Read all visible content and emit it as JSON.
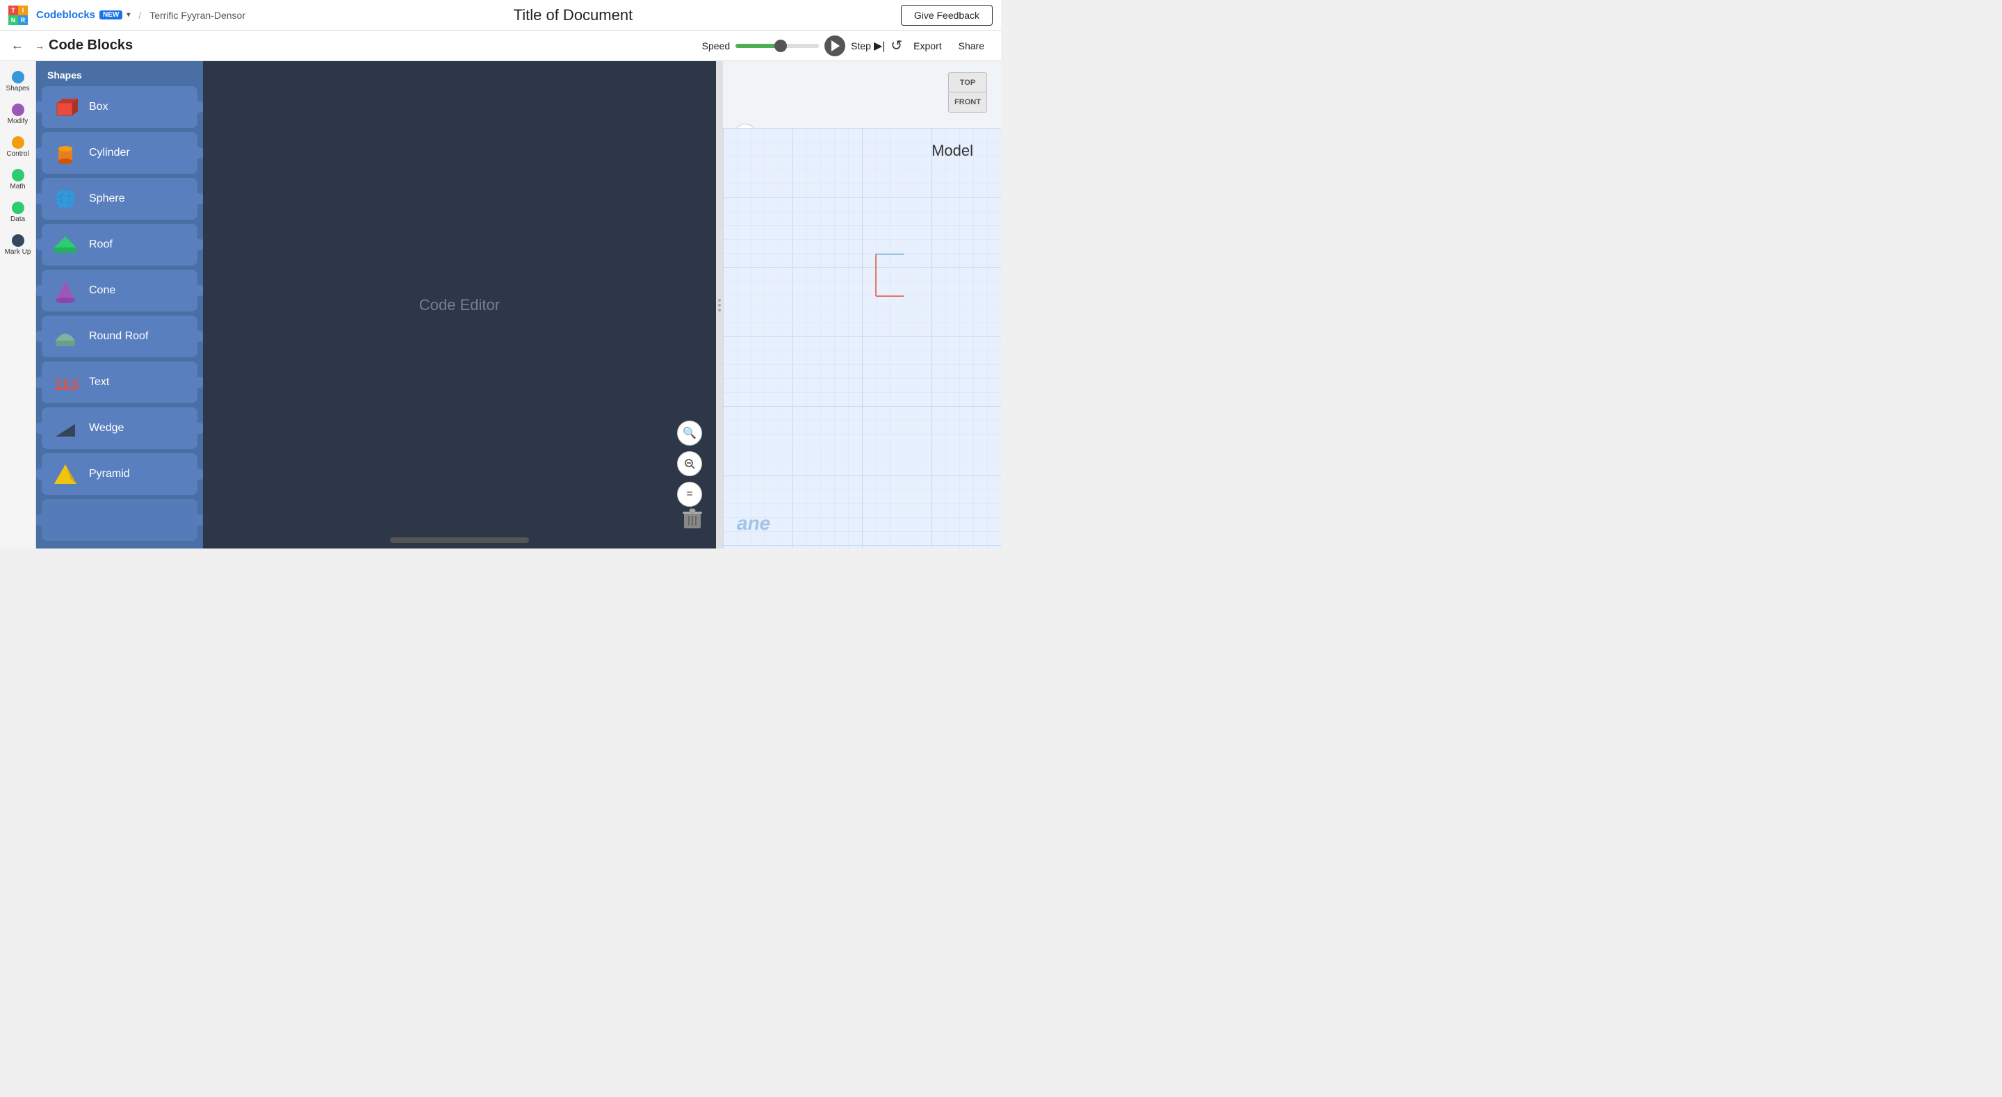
{
  "topbar": {
    "logo": {
      "letters": [
        "T",
        "I",
        "N",
        "R"
      ]
    },
    "codeblocks_label": "Codeblocks",
    "new_badge": "NEW",
    "project_name": "Terrific Fyyran-Densor",
    "doc_title": "Title of Document",
    "give_feedback_label": "Give Feedback"
  },
  "toolbar": {
    "back_icon": "←",
    "arrow_icon": "→",
    "title": "Code Blocks",
    "speed_label": "Speed",
    "step_label": "Step",
    "export_label": "Export",
    "share_label": "Share"
  },
  "categories": [
    {
      "id": "shapes",
      "label": "Shapes",
      "dot_class": "dot-blue"
    },
    {
      "id": "modify",
      "label": "Modify",
      "dot_class": "dot-purple"
    },
    {
      "id": "control",
      "label": "Control",
      "dot_class": "dot-orange"
    },
    {
      "id": "math",
      "label": "Math",
      "dot_class": "dot-green"
    },
    {
      "id": "data",
      "label": "Data",
      "dot_class": "dot-green"
    },
    {
      "id": "markup",
      "label": "Mark Up",
      "dot_class": "dot-dark"
    }
  ],
  "shapes_panel": {
    "header": "Shapes",
    "items": [
      {
        "id": "box",
        "label": "Box",
        "color": "#e74c3c"
      },
      {
        "id": "cylinder",
        "label": "Cylinder",
        "color": "#e67e22"
      },
      {
        "id": "sphere",
        "label": "Sphere",
        "color": "#3498db"
      },
      {
        "id": "roof",
        "label": "Roof",
        "color": "#2ecc71"
      },
      {
        "id": "cone",
        "label": "Cone",
        "color": "#9b59b6"
      },
      {
        "id": "round-roof",
        "label": "Round Roof",
        "color": "#7fb3a0"
      },
      {
        "id": "text",
        "label": "Text",
        "color": "#e74c3c"
      },
      {
        "id": "wedge",
        "label": "Wedge",
        "color": "#2c3e50"
      },
      {
        "id": "pyramid",
        "label": "Pyramid",
        "color": "#f1c40f"
      }
    ]
  },
  "editor": {
    "placeholder": "Code Editor"
  },
  "viewport": {
    "model_label": "Model",
    "view_label": "ane",
    "view_cube": {
      "top_label": "TOP",
      "front_label": "FRONT"
    },
    "zoom_in": "+",
    "zoom_out": "−",
    "home": "⌂"
  },
  "editor_zoom": {
    "zoom_in": "⊕",
    "zoom_out": "⊖",
    "fit": "="
  },
  "speed_value": 55
}
